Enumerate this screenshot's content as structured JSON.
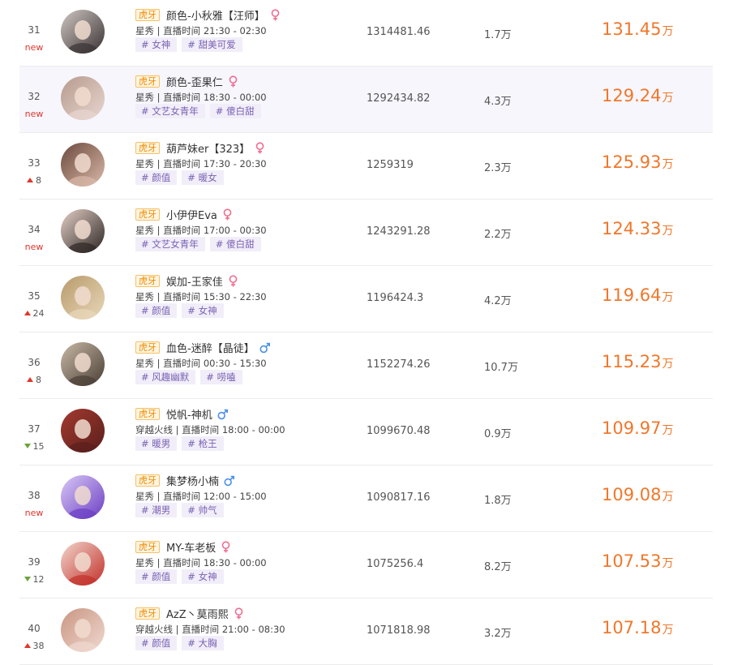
{
  "ranking": {
    "unit": "万",
    "rows": [
      {
        "rank": "31",
        "trend_type": "new",
        "trend_text": "new",
        "platform": "虎牙",
        "name": "颜色-小秋雅【汪师】",
        "gender": "female",
        "category": "星秀",
        "schedule_label": "直播时间",
        "schedule_time": "21:30 - 02:30",
        "tags": [
          "# 女神",
          "# 甜美可爱"
        ],
        "score": "1314481.46",
        "fans": "1.7万",
        "heat": "131.45",
        "avatar_colors": [
          "#3a3334",
          "#cfc7c2"
        ]
      },
      {
        "rank": "32",
        "trend_type": "new",
        "trend_text": "new",
        "platform": "虎牙",
        "name": "颜色-歪果仁",
        "gender": "female",
        "category": "星秀",
        "schedule_label": "直播时间",
        "schedule_time": "18:30 - 00:00",
        "tags": [
          "# 文艺女青年",
          "# 傻白甜"
        ],
        "score": "1292434.82",
        "fans": "4.3万",
        "heat": "129.24",
        "avatar_colors": [
          "#e7d6d0",
          "#b79a8d"
        ]
      },
      {
        "rank": "33",
        "trend_type": "up",
        "trend_text": "8",
        "platform": "虎牙",
        "name": "葫芦妹er【323】",
        "gender": "female",
        "category": "星秀",
        "schedule_label": "直播时间",
        "schedule_time": "17:30 - 20:30",
        "tags": [
          "# 颜值",
          "# 暖女"
        ],
        "score": "1259319",
        "fans": "2.3万",
        "heat": "125.93",
        "avatar_colors": [
          "#d9b8a8",
          "#6b4a3e"
        ]
      },
      {
        "rank": "34",
        "trend_type": "new",
        "trend_text": "new",
        "platform": "虎牙",
        "name": "小伊伊Eva",
        "gender": "female",
        "category": "星秀",
        "schedule_label": "直播时间",
        "schedule_time": "17:00 - 00:30",
        "tags": [
          "# 文艺女青年",
          "# 傻白甜"
        ],
        "score": "1243291.28",
        "fans": "2.2万",
        "heat": "124.33",
        "avatar_colors": [
          "#2d2624",
          "#e4cfc6"
        ]
      },
      {
        "rank": "35",
        "trend_type": "up",
        "trend_text": "24",
        "platform": "虎牙",
        "name": "娱加-王家佳",
        "gender": "female",
        "category": "星秀",
        "schedule_label": "直播时间",
        "schedule_time": "15:30 - 22:30",
        "tags": [
          "# 颜值",
          "# 女神"
        ],
        "score": "1196424.3",
        "fans": "4.2万",
        "heat": "119.64",
        "avatar_colors": [
          "#e8d7b9",
          "#b89a6a"
        ]
      },
      {
        "rank": "36",
        "trend_type": "up",
        "trend_text": "8",
        "platform": "虎牙",
        "name": "血色-迷醉【晶徒】",
        "gender": "male",
        "category": "星秀",
        "schedule_label": "直播时间",
        "schedule_time": "00:30 - 15:30",
        "tags": [
          "# 风趣幽默",
          "# 唠嗑"
        ],
        "score": "1152274.26",
        "fans": "10.7万",
        "heat": "115.23",
        "avatar_colors": [
          "#4a3f36",
          "#c8b8a6"
        ]
      },
      {
        "rank": "37",
        "trend_type": "down",
        "trend_text": "15",
        "platform": "虎牙",
        "name": "悦帆-神机",
        "gender": "male",
        "category": "穿越火线",
        "schedule_label": "直播时间",
        "schedule_time": "18:00 - 00:00",
        "tags": [
          "# 暖男",
          "# 枪王"
        ],
        "score": "1099670.48",
        "fans": "0.9万",
        "heat": "109.97",
        "avatar_colors": [
          "#5a1f1c",
          "#a33a30"
        ]
      },
      {
        "rank": "38",
        "trend_type": "new",
        "trend_text": "new",
        "platform": "虎牙",
        "name": "集梦杨小楠",
        "gender": "male",
        "category": "星秀",
        "schedule_label": "直播时间",
        "schedule_time": "12:00 - 15:00",
        "tags": [
          "# 潮男",
          "# 帅气"
        ],
        "score": "1090817.16",
        "fans": "1.8万",
        "heat": "109.08",
        "avatar_colors": [
          "#6b3fc4",
          "#d9c8f5"
        ]
      },
      {
        "rank": "39",
        "trend_type": "down",
        "trend_text": "12",
        "platform": "虎牙",
        "name": "MY-车老板",
        "gender": "female",
        "category": "星秀",
        "schedule_label": "直播时间",
        "schedule_time": "18:30 - 00:00",
        "tags": [
          "# 颜值",
          "# 女神"
        ],
        "score": "1075256.4",
        "fans": "8.2万",
        "heat": "107.53",
        "avatar_colors": [
          "#c2302a",
          "#f1d6cc"
        ]
      },
      {
        "rank": "40",
        "trend_type": "up",
        "trend_text": "38",
        "platform": "虎牙",
        "name": "AzZ丶莫雨熙",
        "gender": "female",
        "category": "穿越火线",
        "schedule_label": "直播时间",
        "schedule_time": "21:00 - 08:30",
        "tags": [
          "# 颜值",
          "# 大胸"
        ],
        "score": "1071818.98",
        "fans": "3.2万",
        "heat": "107.18",
        "avatar_colors": [
          "#f0d9d0",
          "#c99582"
        ]
      }
    ]
  }
}
